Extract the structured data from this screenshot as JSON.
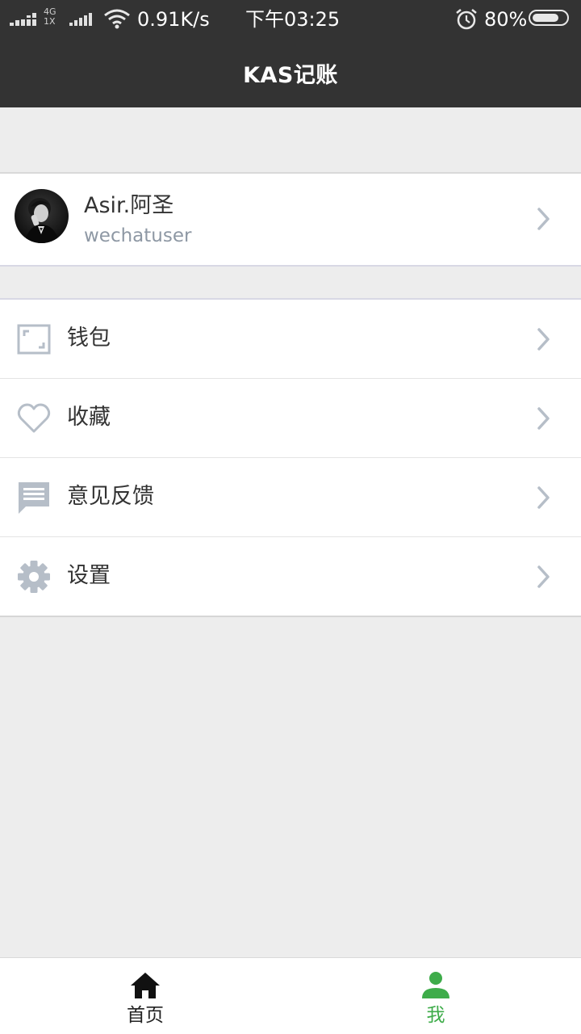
{
  "status_bar": {
    "network_type_top": "4G",
    "network_type_bottom": "1X",
    "speed": "0.91K/s",
    "time": "下午03:25",
    "battery": "80%",
    "battery_level": 0.8
  },
  "header": {
    "title": "KAS记账"
  },
  "profile": {
    "name": "Asir.阿圣",
    "username": "wechatuser"
  },
  "menu": {
    "items": [
      {
        "label": "钱包",
        "icon": "wallet-icon"
      },
      {
        "label": "收藏",
        "icon": "heart-icon"
      },
      {
        "label": "意见反馈",
        "icon": "feedback-icon"
      },
      {
        "label": "设置",
        "icon": "gear-icon"
      }
    ]
  },
  "tabs": [
    {
      "label": "首页",
      "icon": "home-icon",
      "active": false
    },
    {
      "label": "我",
      "icon": "person-icon",
      "active": true
    }
  ],
  "colors": {
    "bar_dark": "#333333",
    "background": "#ededed",
    "icon_gray": "#b6bec8",
    "accent_green": "#3eac4a"
  }
}
